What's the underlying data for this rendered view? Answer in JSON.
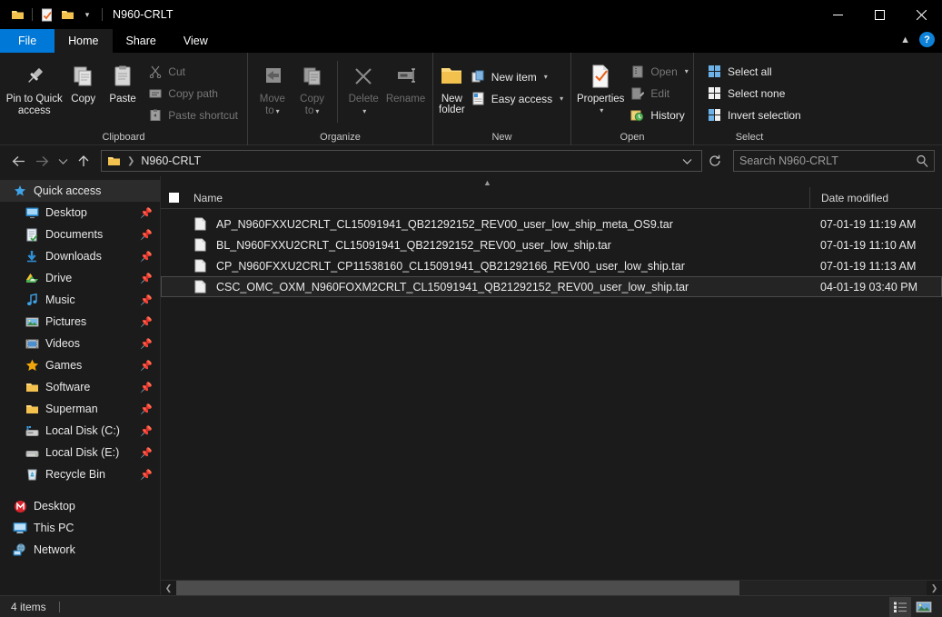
{
  "window": {
    "title": "N960-CRLT",
    "quick_access_icons": [
      "folder-icon",
      "properties-check-icon",
      "new-folder-icon",
      "customize-qat-chevron-icon"
    ],
    "controls": {
      "minimize": "minimize-icon",
      "maximize": "maximize-icon",
      "close": "close-icon"
    }
  },
  "tabs": [
    {
      "label": "File",
      "id": "file"
    },
    {
      "label": "Home",
      "id": "home"
    },
    {
      "label": "Share",
      "id": "share"
    },
    {
      "label": "View",
      "id": "view"
    }
  ],
  "ribbon": {
    "collapse_icon": "chevron-up-icon",
    "help_label": "?",
    "groups": [
      {
        "name": "Clipboard",
        "label": "Clipboard",
        "big_buttons": [
          {
            "label": "Pin to Quick access",
            "icon": "pin-icon"
          },
          {
            "label": "Copy",
            "icon": "copy-icon"
          },
          {
            "label": "Paste",
            "icon": "paste-icon"
          }
        ],
        "small_buttons": [
          {
            "label": "Cut",
            "icon": "scissors-icon",
            "disabled": true
          },
          {
            "label": "Copy path",
            "icon": "copy-path-icon",
            "disabled": true
          },
          {
            "label": "Paste shortcut",
            "icon": "paste-shortcut-icon",
            "disabled": true
          }
        ]
      },
      {
        "name": "Organize",
        "label": "Organize",
        "big_buttons": [
          {
            "label": "Move to",
            "icon": "move-to-icon",
            "caret": true,
            "disabled": true
          },
          {
            "label": "Copy to",
            "icon": "copy-to-icon",
            "caret": true,
            "disabled": true
          },
          {
            "label": "Delete",
            "icon": "delete-x-icon",
            "caret": true,
            "disabled": true
          },
          {
            "label": "Rename",
            "icon": "rename-icon",
            "disabled": true
          }
        ]
      },
      {
        "name": "New",
        "label": "New",
        "big_buttons": [
          {
            "label": "New folder",
            "icon": "new-folder-icon"
          }
        ],
        "small_buttons": [
          {
            "label": "New item",
            "icon": "new-item-icon",
            "caret": true
          },
          {
            "label": "Easy access",
            "icon": "easy-access-icon",
            "caret": true
          }
        ]
      },
      {
        "name": "Open",
        "label": "Open",
        "big_buttons": [
          {
            "label": "Properties",
            "icon": "properties-icon",
            "caret": true
          }
        ],
        "small_buttons": [
          {
            "label": "Open",
            "icon": "open-icon",
            "caret": true,
            "disabled": true
          },
          {
            "label": "Edit",
            "icon": "edit-icon",
            "disabled": true
          },
          {
            "label": "History",
            "icon": "history-icon"
          }
        ]
      },
      {
        "name": "Select",
        "label": "Select",
        "small_buttons": [
          {
            "label": "Select all",
            "icon": "select-all-icon"
          },
          {
            "label": "Select none",
            "icon": "select-none-icon"
          },
          {
            "label": "Invert selection",
            "icon": "invert-selection-icon"
          }
        ]
      }
    ]
  },
  "addressbar": {
    "back_icon": "arrow-left-icon",
    "forward_icon": "arrow-right-icon",
    "recent_icon": "chevron-down-icon",
    "up_icon": "arrow-up-icon",
    "breadcrumb_icon": "folder-icon",
    "breadcrumb": "N960-CRLT",
    "dropdown_icon": "chevron-down-icon",
    "refresh_icon": "refresh-icon",
    "search_placeholder": "Search N960-CRLT",
    "search_value": "",
    "search_icon": "search-icon"
  },
  "sidebar": {
    "groups": [
      {
        "header": {
          "label": "Quick access",
          "icon": "star-icon",
          "selected": true
        },
        "items": [
          {
            "label": "Desktop",
            "icon": "desktop-icon",
            "pinned": true
          },
          {
            "label": "Documents",
            "icon": "documents-icon",
            "pinned": true
          },
          {
            "label": "Downloads",
            "icon": "downloads-icon",
            "pinned": true
          },
          {
            "label": "Drive",
            "icon": "drive-icon",
            "pinned": true
          },
          {
            "label": "Music",
            "icon": "music-icon",
            "pinned": true
          },
          {
            "label": "Pictures",
            "icon": "pictures-icon",
            "pinned": true
          },
          {
            "label": "Videos",
            "icon": "videos-icon",
            "pinned": true
          },
          {
            "label": "Games",
            "icon": "games-star-icon",
            "pinned": true
          },
          {
            "label": "Software",
            "icon": "folder-icon",
            "pinned": true
          },
          {
            "label": "Superman",
            "icon": "folder-icon",
            "pinned": true
          },
          {
            "label": "Local Disk (C:)",
            "icon": "system-drive-icon",
            "pinned": true
          },
          {
            "label": "Local Disk (E:)",
            "icon": "drive-disk-icon",
            "pinned": true
          },
          {
            "label": "Recycle Bin",
            "icon": "recycle-bin-icon",
            "pinned": true
          }
        ]
      },
      {
        "roots": [
          {
            "label": "Desktop",
            "icon": "mega-desktop-icon"
          },
          {
            "label": "This PC",
            "icon": "this-pc-icon"
          },
          {
            "label": "Network",
            "icon": "network-icon"
          }
        ]
      }
    ]
  },
  "filelist": {
    "sort_indicator": "sort-ascending-icon",
    "columns": [
      {
        "label": "Name",
        "key": "name"
      },
      {
        "label": "Date modified",
        "key": "date"
      }
    ],
    "header_checkbox_icon": "checkbox-icon",
    "rows": [
      {
        "icon": "file-icon",
        "name": "AP_N960FXXU2CRLT_CL15091941_QB21292152_REV00_user_low_ship_meta_OS9.tar",
        "date": "07-01-19 11:19 AM",
        "selected": false
      },
      {
        "icon": "file-icon",
        "name": "BL_N960FXXU2CRLT_CL15091941_QB21292152_REV00_user_low_ship.tar",
        "date": "07-01-19 11:10 AM",
        "selected": false
      },
      {
        "icon": "file-icon",
        "name": "CP_N960FXXU2CRLT_CP11538160_CL15091941_QB21292166_REV00_user_low_ship.tar",
        "date": "07-01-19 11:13 AM",
        "selected": false
      },
      {
        "icon": "file-icon",
        "name": "CSC_OMC_OXM_N960FOXM2CRLT_CL15091941_QB21292152_REV00_user_low_ship.tar",
        "date": "04-01-19 03:40 PM",
        "selected": true
      }
    ]
  },
  "scrollbar": {
    "left_arrow_icon": "chevron-left-icon",
    "right_arrow_icon": "chevron-right-icon",
    "thumb_percent": 75
  },
  "statusbar": {
    "item_count": "4 items",
    "views": [
      {
        "name": "details-view",
        "icon": "details-view-icon",
        "active": true
      },
      {
        "name": "large-icons-view",
        "icon": "large-icons-view-icon",
        "active": false
      }
    ]
  },
  "colors": {
    "accent": "#0078d7",
    "window_bg": "#1b1b1b",
    "titlebar_bg": "#000000",
    "selection_bg": "#242424",
    "folder_yellow": "#f7d070"
  }
}
